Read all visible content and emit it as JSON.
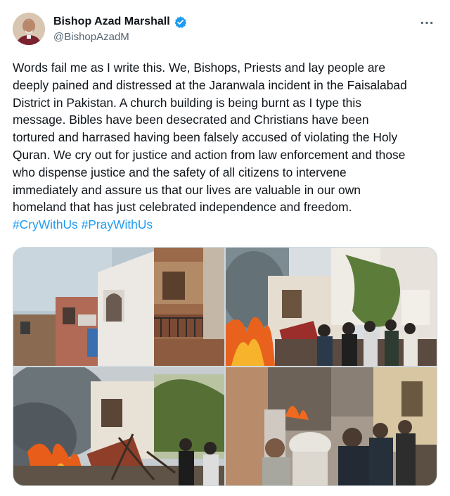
{
  "author": {
    "display_name": "Bishop Azad Marshall",
    "handle": "@BishopAzadM",
    "verified": true,
    "avatar_icon": "person-avatar",
    "verified_icon": "verified-badge-icon",
    "verified_color": "#1d9bf0"
  },
  "menu": {
    "icon": "more-horizontal-icon"
  },
  "tweet": {
    "lines": [
      "Words fail me as I write this. We, Bishops, Priests and lay people are",
      "deeply pained and distressed at the Jaranwala incident in the Faisalabad",
      "District in Pakistan. A church building is being burnt as I type this",
      "message. Bibles have been desecrated and Christians have been",
      "tortured and harrased having been falsely accused of violating the Holy",
      "Quran. We cry out for justice and action from law enforcement and those",
      "who dispense justice and the safety of all citizens to intervene",
      "immediately and assure us that our lives are valuable in our own",
      "homeland that has just celebrated independence and freedom."
    ],
    "hashtags": [
      "#CryWithUs",
      "#PrayWithUs"
    ],
    "hashtag_color": "#1d9bf0"
  },
  "media": {
    "photos": [
      {
        "name": "photo-church-building"
      },
      {
        "name": "photo-fire-street"
      },
      {
        "name": "photo-burning-furniture"
      },
      {
        "name": "photo-police-crowd"
      }
    ]
  }
}
